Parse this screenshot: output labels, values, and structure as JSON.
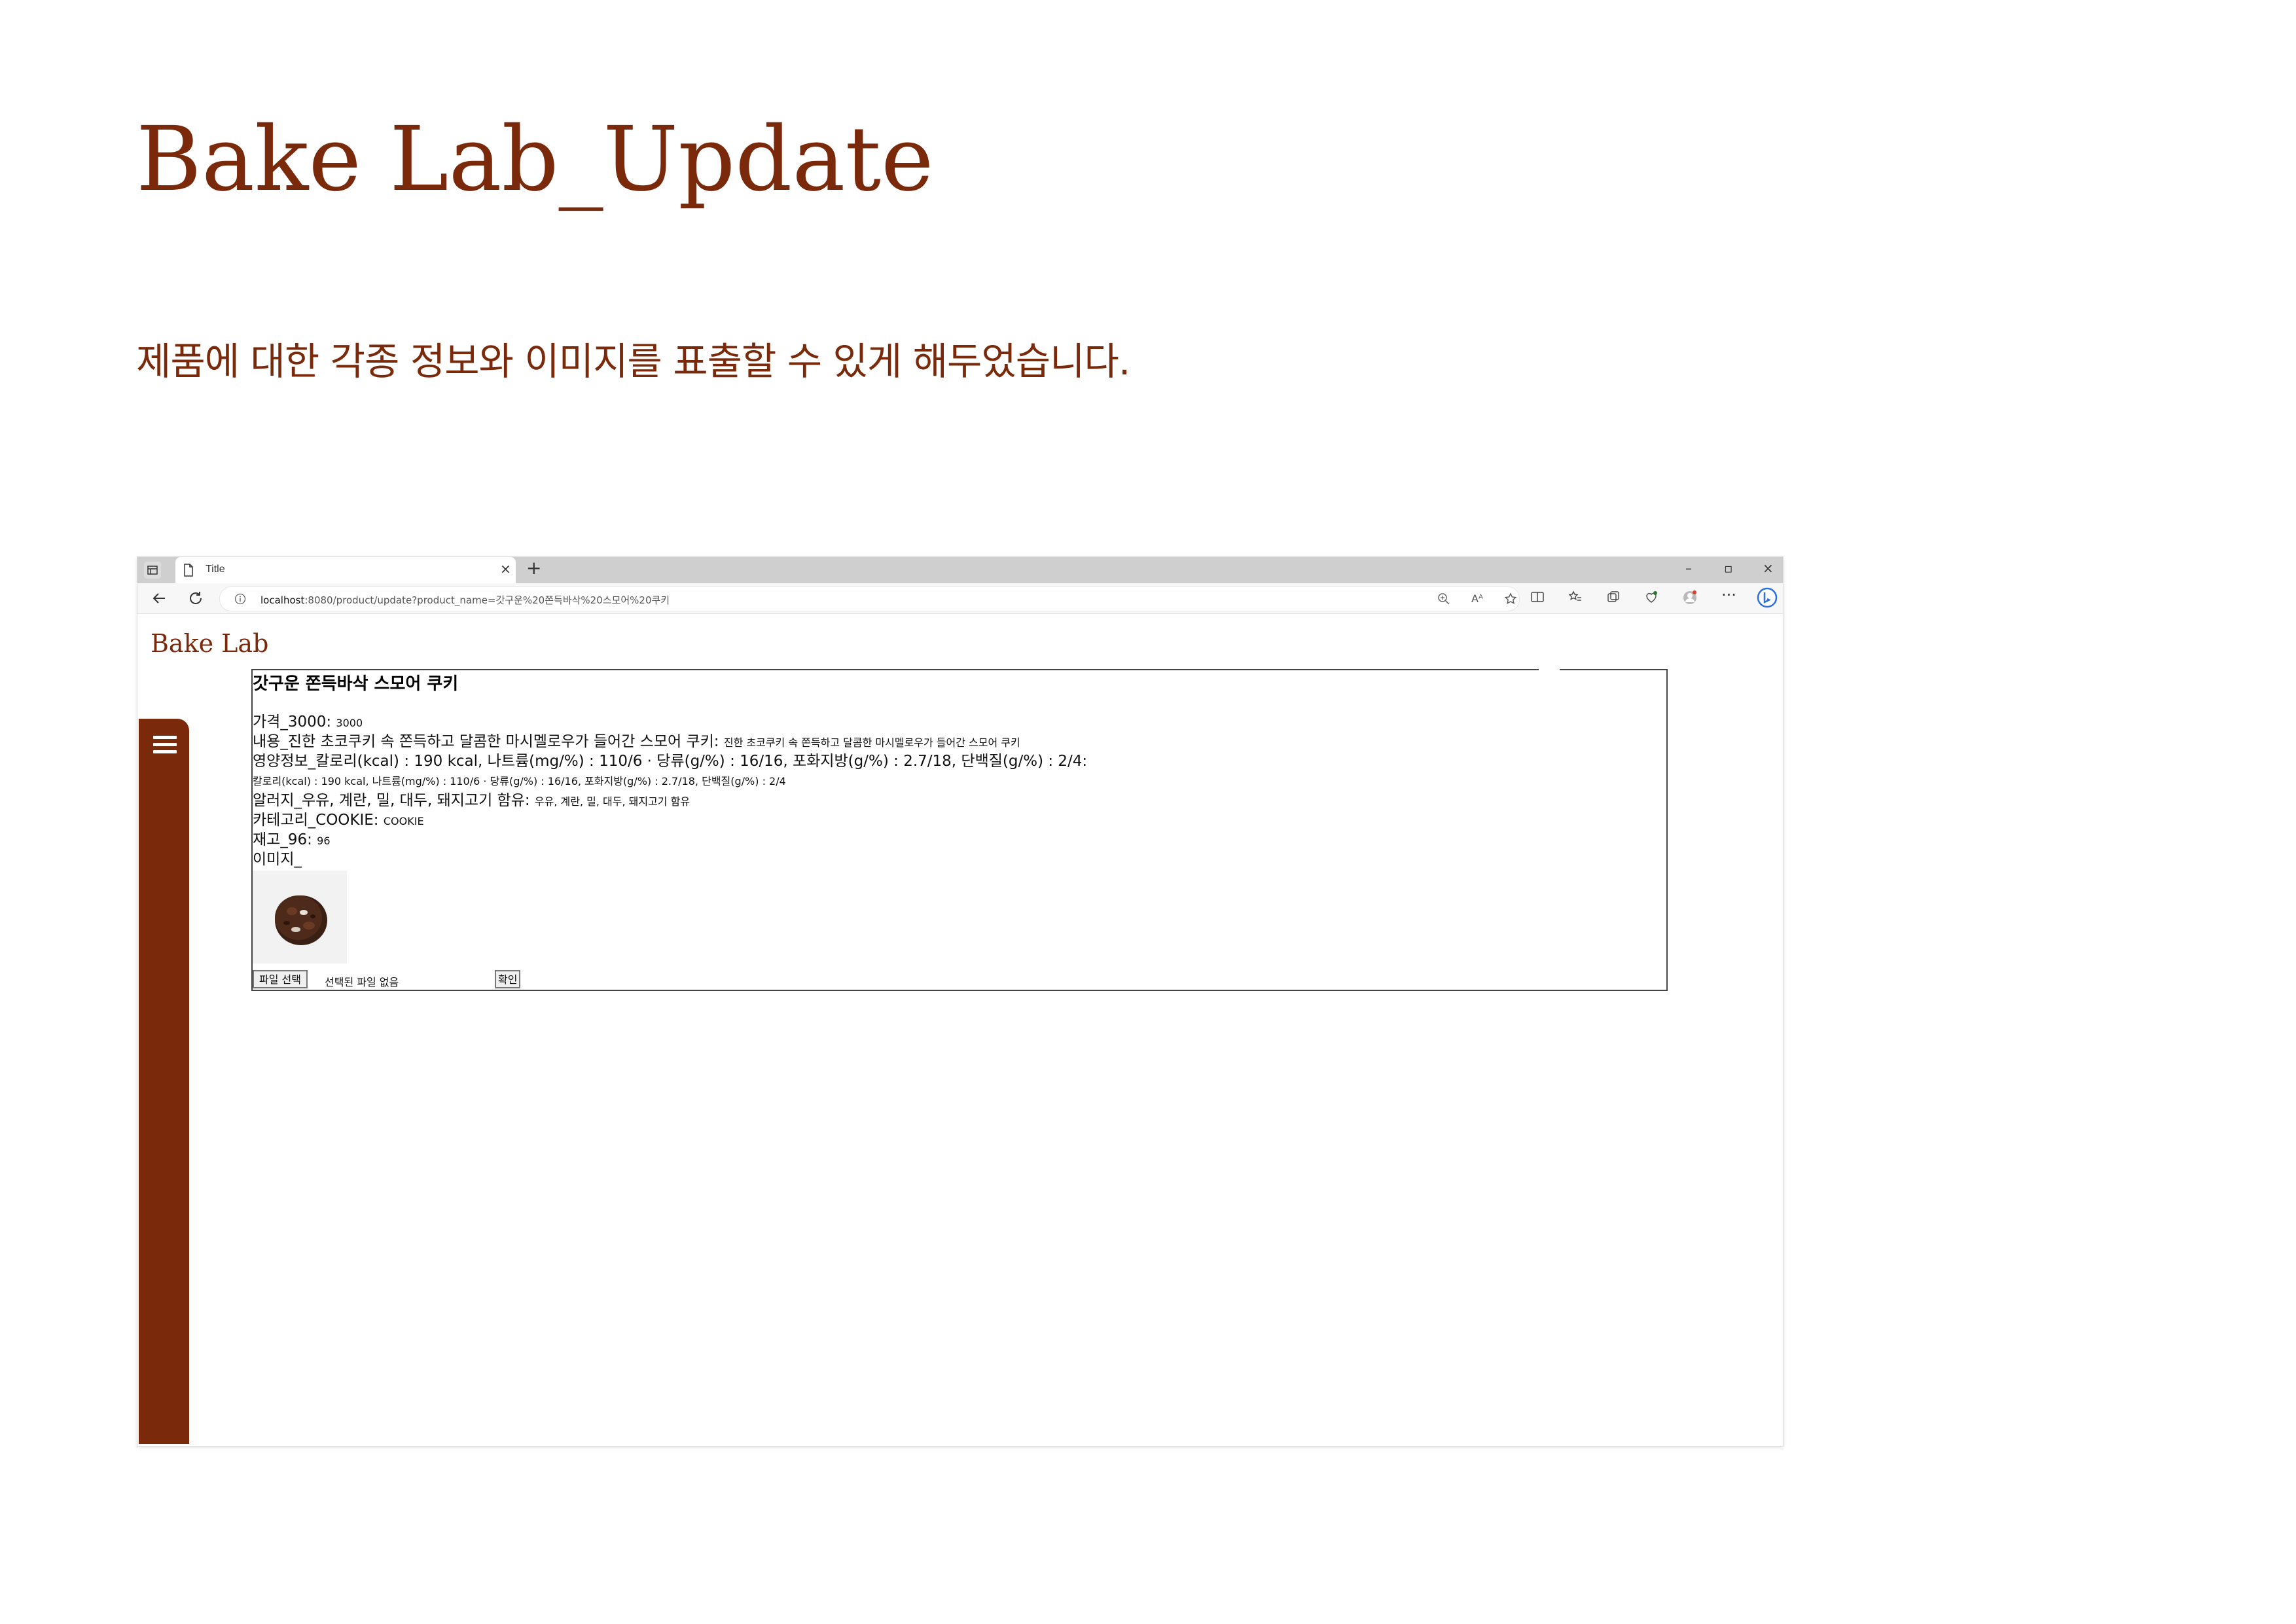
{
  "slide": {
    "title": "Bake Lab_Update",
    "subtitle": "제품에 대한 각종 정보와 이미지를 표출할 수 있게 해두었습니다."
  },
  "browser": {
    "tab_title": "Title",
    "url_host": "localhost",
    "url_rest": ":8080/product/update?product_name=갓구운%20쫀득바삭%20스모어%20쿠키"
  },
  "page": {
    "brand": "Bake Lab",
    "product": {
      "name": "갓구운 쫀득바삭 스모어 쿠키",
      "price_label": "가격_3000: ",
      "price_value": "3000",
      "content_label": "내용_진한 초코쿠키 속 쫀득하고 달콤한 마시멜로우가 들어간 스모어 쿠키: ",
      "content_value": "진한 초코쿠키 속 쫀득하고 달콤한 마시멜로우가 들어간 스모어 쿠키",
      "nutrition_label": "영양정보_칼로리(kcal) : 190 kcal, 나트륨(mg/%) : 110/6 · 당류(g/%) : 16/16, 포화지방(g/%) : 2.7/18, 단백질(g/%) : 2/4:",
      "nutrition_value": "칼로리(kcal) : 190 kcal, 나트륨(mg/%) : 110/6 · 당류(g/%) : 16/16, 포화지방(g/%) : 2.7/18, 단백질(g/%) : 2/4",
      "allergy_label": "알러지_우유, 계란, 밀, 대두, 돼지고기 함유: ",
      "allergy_value": "우유, 계란, 밀, 대두, 돼지고기 함유",
      "category_label": "카테고리_COOKIE: ",
      "category_value": "COOKIE",
      "stock_label": "재고_96: ",
      "stock_value": "96",
      "image_label": "이미지_"
    },
    "file_button": "파일 선택",
    "file_status": "선택된 파일 없음",
    "confirm_button": "확인"
  },
  "colors": {
    "brand": "#7a2a0a",
    "tabbar": "#cfcfcf"
  }
}
